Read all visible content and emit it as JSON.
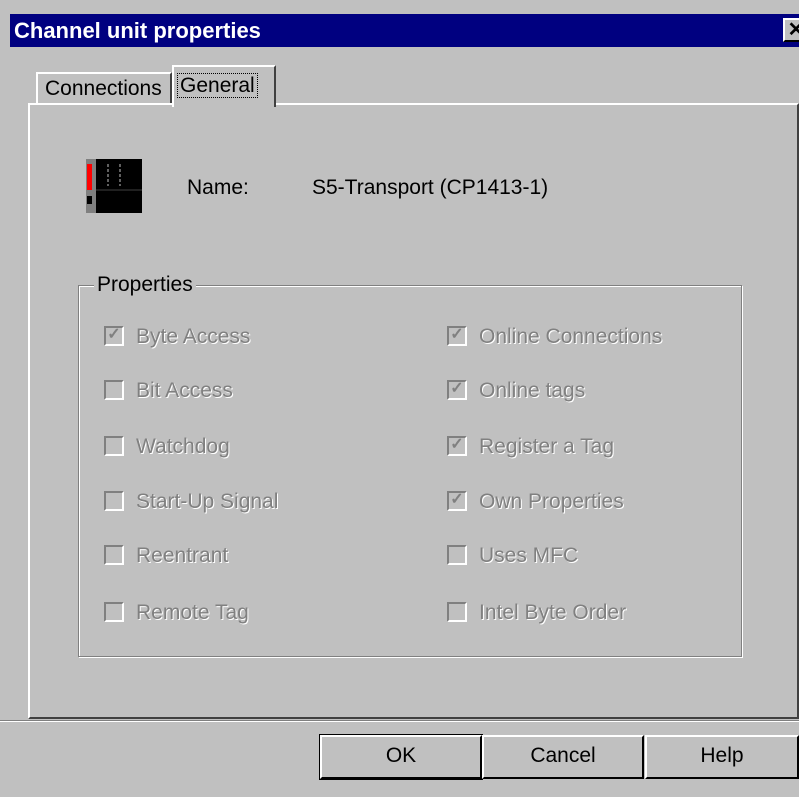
{
  "window": {
    "title": "Channel unit properties",
    "close_glyph": "✕"
  },
  "tabs": [
    {
      "label": "Connections",
      "active": false
    },
    {
      "label": "General",
      "active": true
    }
  ],
  "general": {
    "device_icon": "channel-unit-device-icon",
    "name_label": "Name:",
    "name_value": "S5-Transport (CP1413-1)"
  },
  "properties": {
    "legend": "Properties",
    "left": [
      {
        "label": "Byte Access",
        "checked": true
      },
      {
        "label": "Bit Access",
        "checked": false
      },
      {
        "label": "Watchdog",
        "checked": false
      },
      {
        "label": "Start-Up Signal",
        "checked": false
      },
      {
        "label": "Reentrant",
        "checked": false
      },
      {
        "label": "Remote Tag",
        "checked": false
      }
    ],
    "right": [
      {
        "label": "Online Connections",
        "checked": true
      },
      {
        "label": "Online tags",
        "checked": true
      },
      {
        "label": "Register a Tag",
        "checked": true
      },
      {
        "label": "Own Properties",
        "checked": true
      },
      {
        "label": "Uses MFC",
        "checked": false
      },
      {
        "label": "Intel Byte Order",
        "checked": false
      }
    ],
    "check_glyph": "✓"
  },
  "buttons": {
    "ok": "OK",
    "cancel": "Cancel",
    "help": "Help"
  },
  "colors": {
    "title_bar": "#000080",
    "face": "#c0c0c0",
    "disabled_text": "#808080"
  }
}
